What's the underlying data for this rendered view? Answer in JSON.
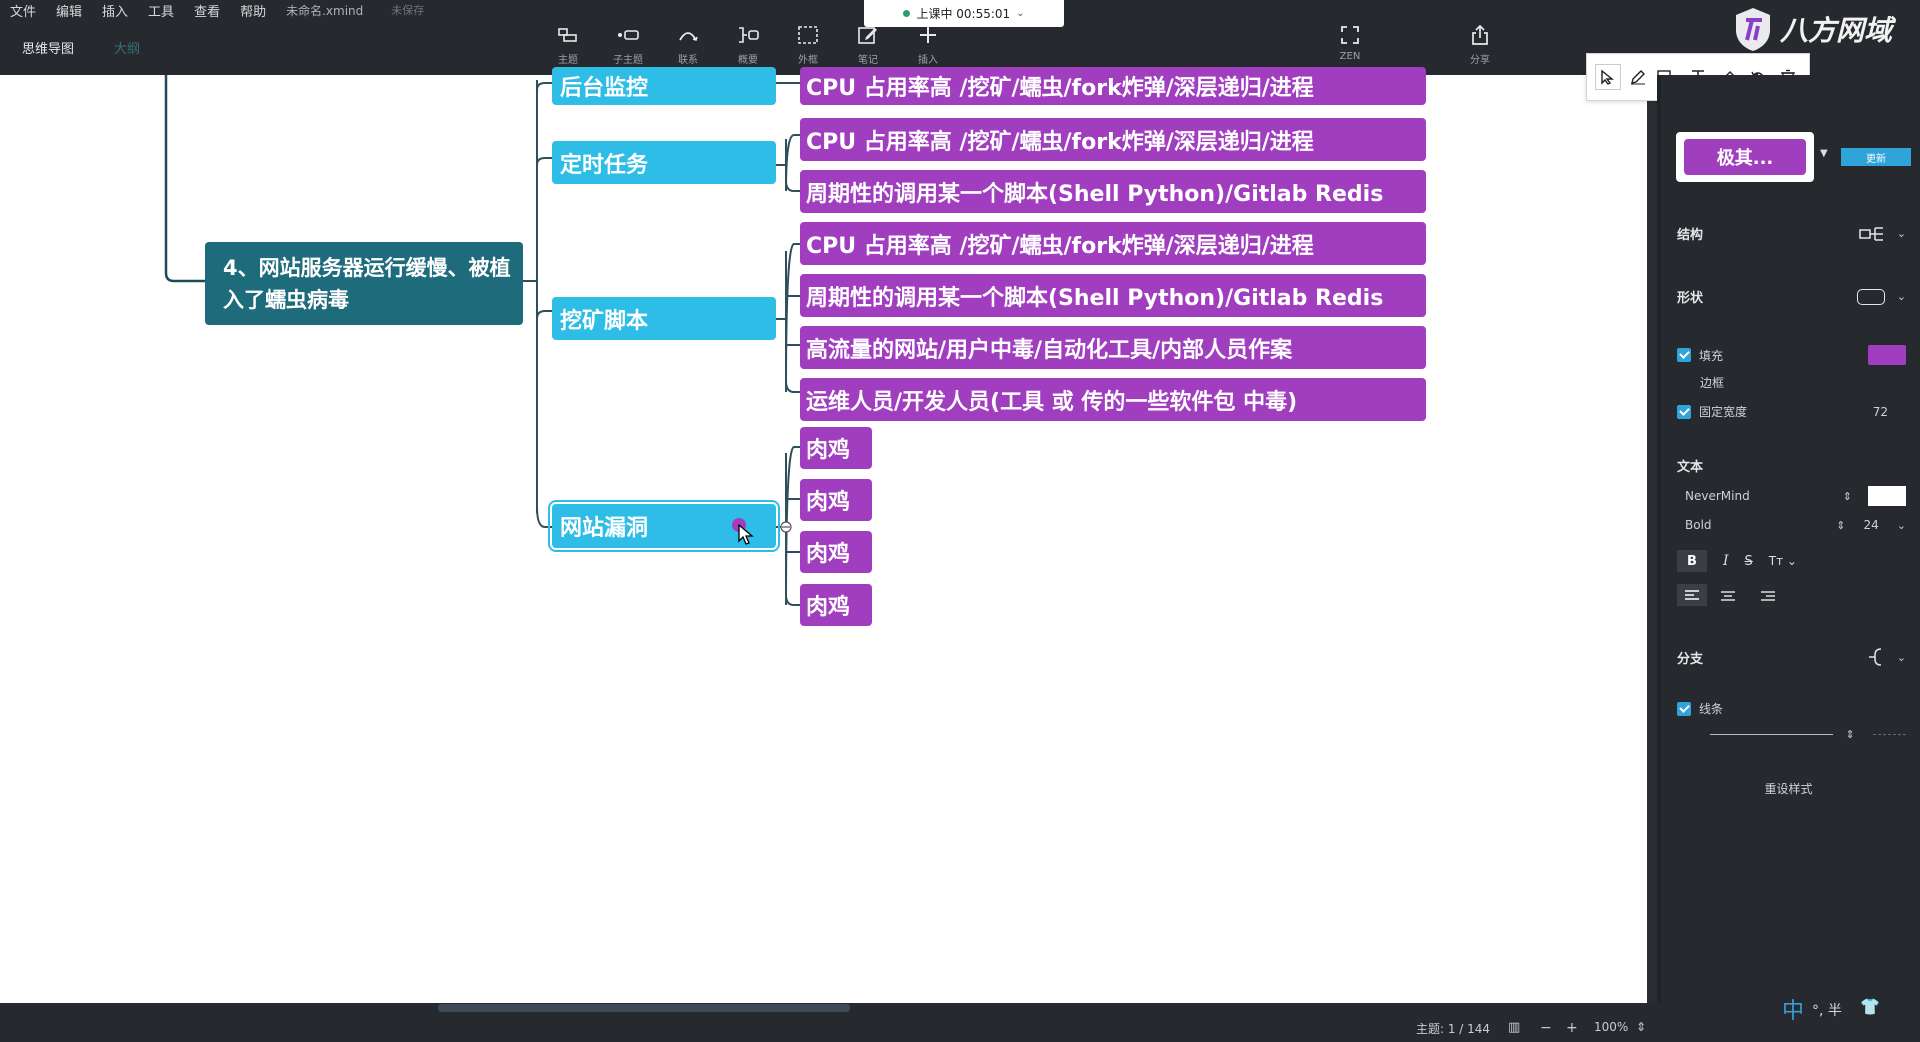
{
  "menu": {
    "items": [
      "文件",
      "编辑",
      "插入",
      "工具",
      "查看",
      "帮助"
    ],
    "file_name": "未命名.xmind",
    "save_status": "未保存"
  },
  "view_tabs": {
    "mindmap": "思维导图",
    "outline": "大纲"
  },
  "toolbar": [
    {
      "label": "主题",
      "icon": "topic-icon"
    },
    {
      "label": "子主题",
      "icon": "subtopic-icon"
    },
    {
      "label": "联系",
      "icon": "relationship-icon"
    },
    {
      "label": "概要",
      "icon": "summary-icon"
    },
    {
      "label": "外框",
      "icon": "boundary-icon"
    },
    {
      "label": "笔记",
      "icon": "note-icon"
    },
    {
      "label": "插入",
      "icon": "plus-icon"
    }
  ],
  "zen_label": "ZEN",
  "share_label": "分享",
  "recording": {
    "text": "上课中 00:55:01"
  },
  "logo": {
    "text": "八方网域"
  },
  "mindmap": {
    "root": "4、网站服务器运行缓慢、被植入了蠕虫病毒",
    "branches": [
      {
        "label": "后台监控",
        "children": [
          "CPU 占用率高 /挖矿/蠕虫/fork炸弹/深层递归/进程"
        ]
      },
      {
        "label": "定时任务",
        "children": [
          "CPU 占用率高 /挖矿/蠕虫/fork炸弹/深层递归/进程",
          "周期性的调用某一个脚本(Shell Python)/Gitlab Redis"
        ]
      },
      {
        "label": "挖矿脚本",
        "children": [
          "CPU 占用率高 /挖矿/蠕虫/fork炸弹/深层递归/进程",
          "周期性的调用某一个脚本(Shell Python)/Gitlab Redis",
          "高流量的网站/用户中毒/自动化工具/内部人员作案",
          "运维人员/开发人员(工具 或 传的一些软件包 中毒)"
        ]
      },
      {
        "label": "网站漏洞",
        "children": [
          "肉鸡",
          "肉鸡",
          "肉鸡",
          "肉鸡"
        ]
      }
    ]
  },
  "panel": {
    "style_preview": "极其...",
    "apply_label": "更新",
    "structure_label": "结构",
    "shape_label": "形状",
    "fill_label": "填充",
    "fill_color": "#a13ec0",
    "border_label": "边框",
    "fixed_width_label": "固定宽度",
    "fixed_width_value": "72",
    "text_label": "文本",
    "font_name": "NeverMind",
    "font_color": "#ffffff",
    "font_weight": "Bold",
    "font_size": "24",
    "branch_label": "分支",
    "line_label": "线条",
    "reset_label": "重设样式"
  },
  "status": {
    "topic_count": "主题: 1 / 144",
    "zoom": "100%",
    "ime": "中",
    "ime_extra": "°, 半"
  }
}
